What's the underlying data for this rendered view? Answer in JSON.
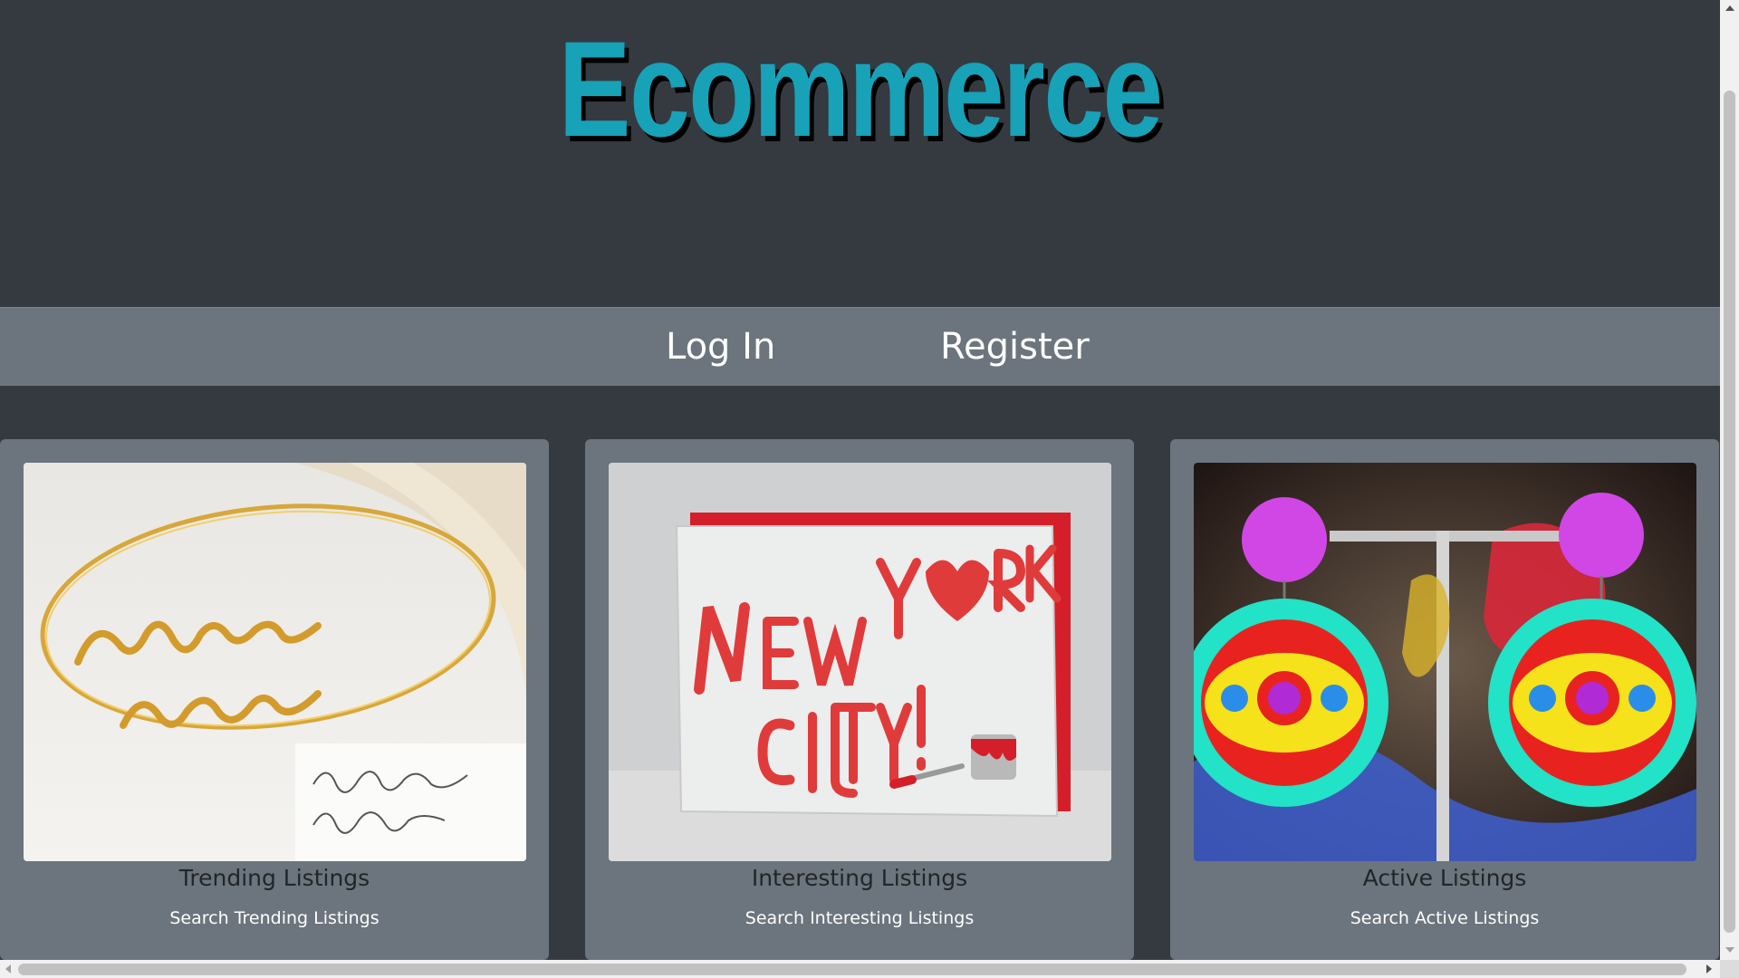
{
  "site": {
    "title": "Ecommerce",
    "title_color": "#17a2b8",
    "background_color": "#343a40"
  },
  "nav": {
    "background_color": "#6c757d",
    "items": [
      {
        "label": "Log In"
      },
      {
        "label": "Register"
      }
    ]
  },
  "cards": [
    {
      "title": "Trending Listings",
      "link": "Search Trending Listings",
      "image": "gold-script-bracelet-photo"
    },
    {
      "title": "Interesting Listings",
      "link": "Search Interesting Listings",
      "image": "new-york-city-greeting-card-photo"
    },
    {
      "title": "Active Listings",
      "link": "Search Active Listings",
      "image": "neon-statement-earrings-photo"
    }
  ]
}
